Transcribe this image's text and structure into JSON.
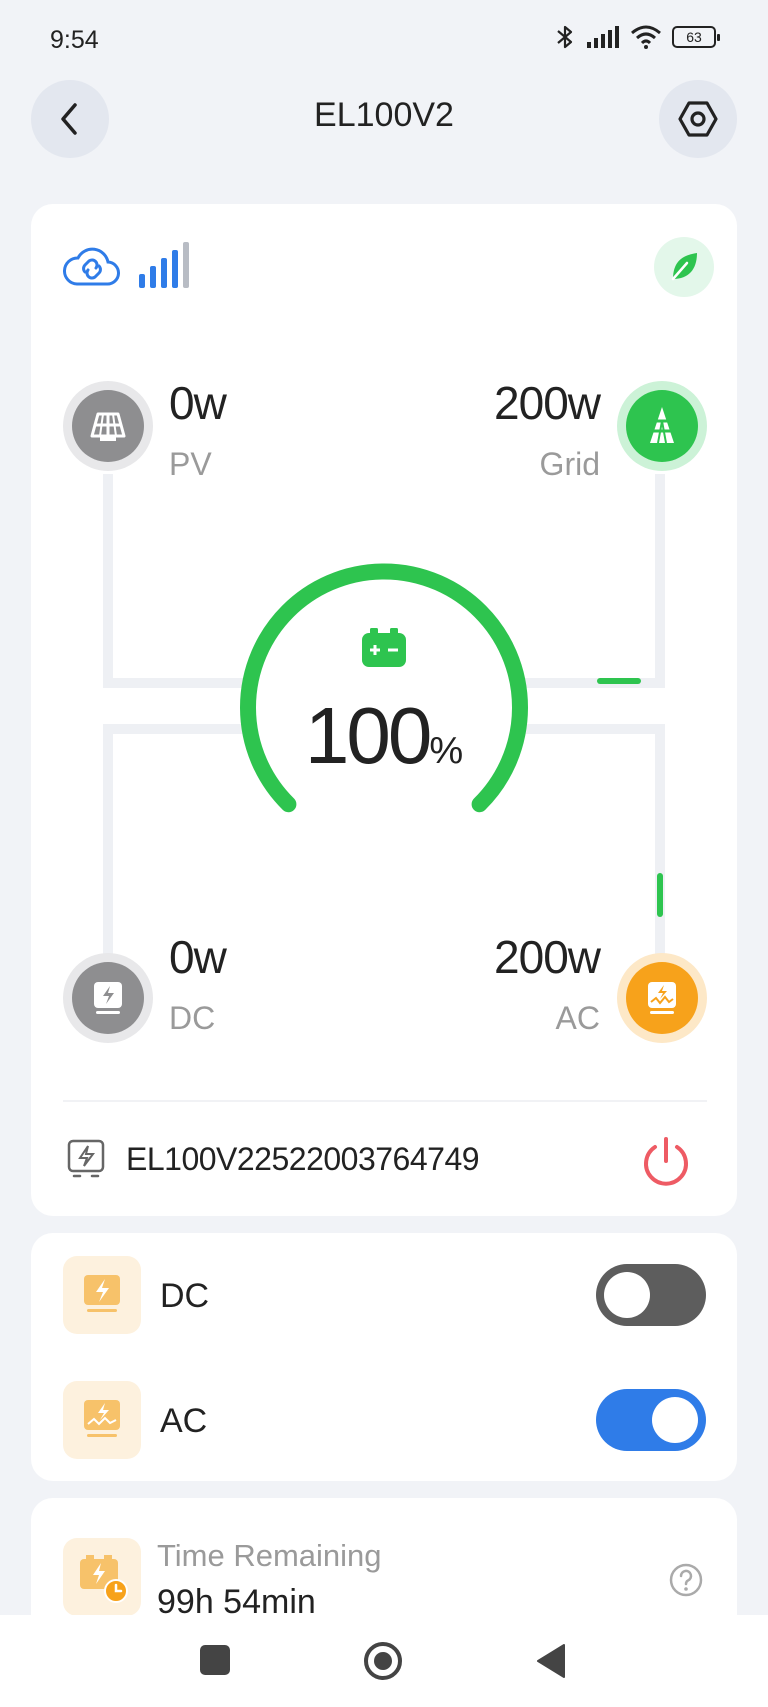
{
  "status_bar": {
    "time": "9:54",
    "battery_level": "63",
    "icons": [
      "bluetooth-icon",
      "cellular-signal-icon",
      "wifi-icon",
      "battery-icon"
    ]
  },
  "header": {
    "title": "EL100V2",
    "back_icon": "chevron-left-icon",
    "settings_icon": "hexagon-settings-icon"
  },
  "energy_flow": {
    "connection_icons": [
      "cloud-link-icon",
      "signal-bars-icon"
    ],
    "eco_icon": "leaf-icon",
    "pv": {
      "value": "0w",
      "label": "PV",
      "icon": "solar-panel-icon"
    },
    "grid": {
      "value": "200w",
      "label": "Grid",
      "icon": "grid-tower-icon"
    },
    "dc": {
      "value": "0w",
      "label": "DC",
      "icon": "dc-output-icon"
    },
    "ac": {
      "value": "200w",
      "label": "AC",
      "icon": "ac-output-icon"
    },
    "battery": {
      "percent": "100",
      "unit": "%",
      "level": 1.0,
      "icon": "battery-icon"
    },
    "colors": {
      "green": "#2ec44f",
      "orange": "#f7a21b",
      "gray": "#9a9a9a"
    }
  },
  "device": {
    "serial": "EL100V22522003764749",
    "device_icon": "device-icon",
    "power_icon": "power-icon"
  },
  "outputs": [
    {
      "label": "DC",
      "enabled": false,
      "icon": "dc-output-icon"
    },
    {
      "label": "AC",
      "enabled": true,
      "icon": "ac-output-icon"
    }
  ],
  "time_remaining": {
    "label": "Time Remaining",
    "value": "99h 54min",
    "help_icon": "question-icon"
  },
  "nav_bar": {
    "icons": [
      "recents-icon",
      "home-icon",
      "back-icon"
    ]
  }
}
